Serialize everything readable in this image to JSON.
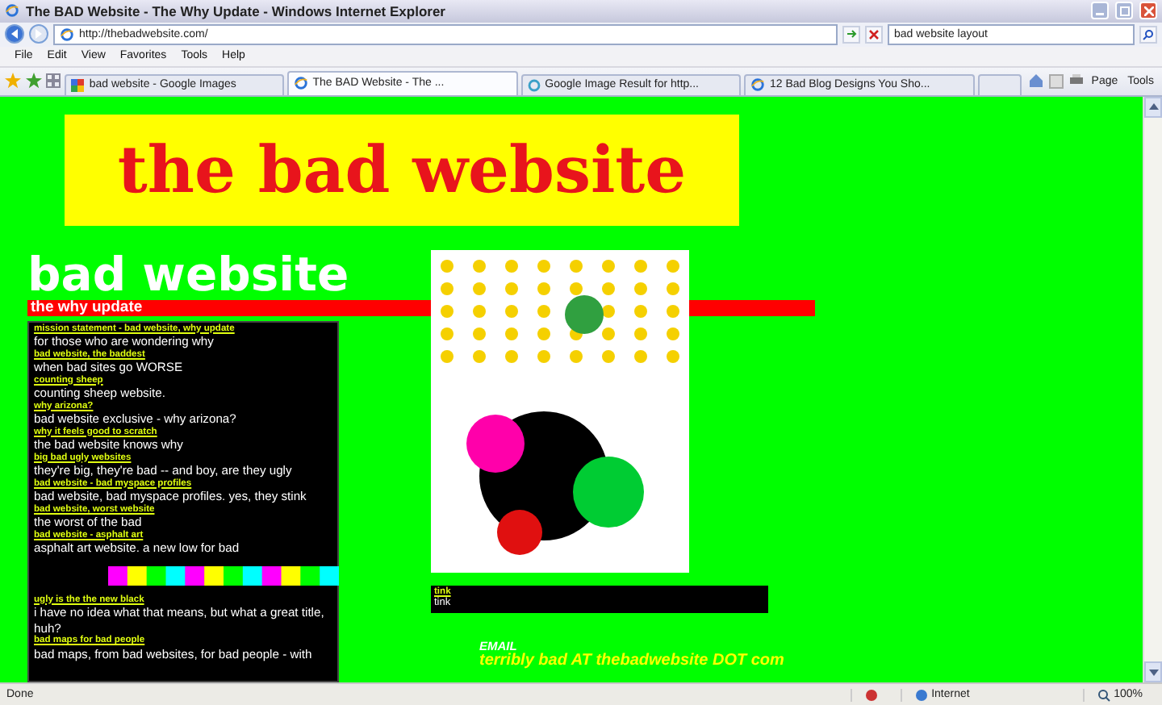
{
  "window": {
    "title": "The BAD Website - The Why Update - Windows Internet Explorer"
  },
  "address_bar": {
    "url": "http://thebadwebsite.com/",
    "search": "bad website layout"
  },
  "menu": [
    "File",
    "Edit",
    "View",
    "Favorites",
    "Tools",
    "Help"
  ],
  "tabs": [
    {
      "label": "bad website - Google Images",
      "selected": false,
      "kind": "google"
    },
    {
      "label": "The BAD Website - The ...",
      "selected": true,
      "kind": "ie"
    },
    {
      "label": "Google Image Result for http...",
      "selected": false,
      "kind": "loading"
    },
    {
      "label": "12 Bad Blog Designs You Sho...",
      "selected": false,
      "kind": "ie"
    }
  ],
  "command_bar": [
    "Page",
    "Tools"
  ],
  "page": {
    "banner": "the bad website",
    "heading": "bad website",
    "subheading": "the why update",
    "posts": [
      {
        "link": "mission statement - bad website, why update",
        "text": "for those who are wondering why"
      },
      {
        "link": "bad website, the baddest",
        "text": "when bad sites go WORSE"
      },
      {
        "link": "counting sheep",
        "text": "counting sheep website."
      },
      {
        "link": "why arizona?",
        "text": "bad website exclusive - why arizona?"
      },
      {
        "link": "why it feels good to scratch",
        "text": "the bad website knows why"
      },
      {
        "link": "big bad ugly websites",
        "text": "they're big, they're bad -- and boy, are they ugly"
      },
      {
        "link": "bad website - bad myspace profiles",
        "text": "bad website, bad myspace profiles. yes, they stink"
      },
      {
        "link": "bad website, worst website",
        "text": "the worst of the bad"
      },
      {
        "link": "bad website - asphalt art",
        "text": "asphalt art website. a new low for bad"
      }
    ],
    "color_strip": [
      {
        "color": "#ff00ff"
      },
      {
        "color": "#ffff00"
      },
      {
        "color": "#00ff00"
      },
      {
        "color": "#00ffff"
      },
      {
        "color": "#ff00ff"
      },
      {
        "color": "#ffff00"
      },
      {
        "color": "#00ff00"
      },
      {
        "color": "#00ffff"
      },
      {
        "color": "#ff00ff"
      },
      {
        "color": "#ffff00"
      },
      {
        "color": "#00ff00"
      },
      {
        "color": "#00ffff"
      }
    ],
    "more_posts": [
      {
        "link": "ugly is the the new black",
        "text": "i have no idea what that means, but what a great title, huh?"
      },
      {
        "link": "bad maps for bad people",
        "text": "bad maps, from bad websites, for bad people - with"
      }
    ],
    "side_box": {
      "link": "tink",
      "text": "tink"
    },
    "email": {
      "label": "EMAIL",
      "address": "terribly bad AT thebadwebsite DOT com"
    }
  },
  "status_bar": {
    "status": "Done",
    "zone": "Internet",
    "zoom": "100%"
  }
}
